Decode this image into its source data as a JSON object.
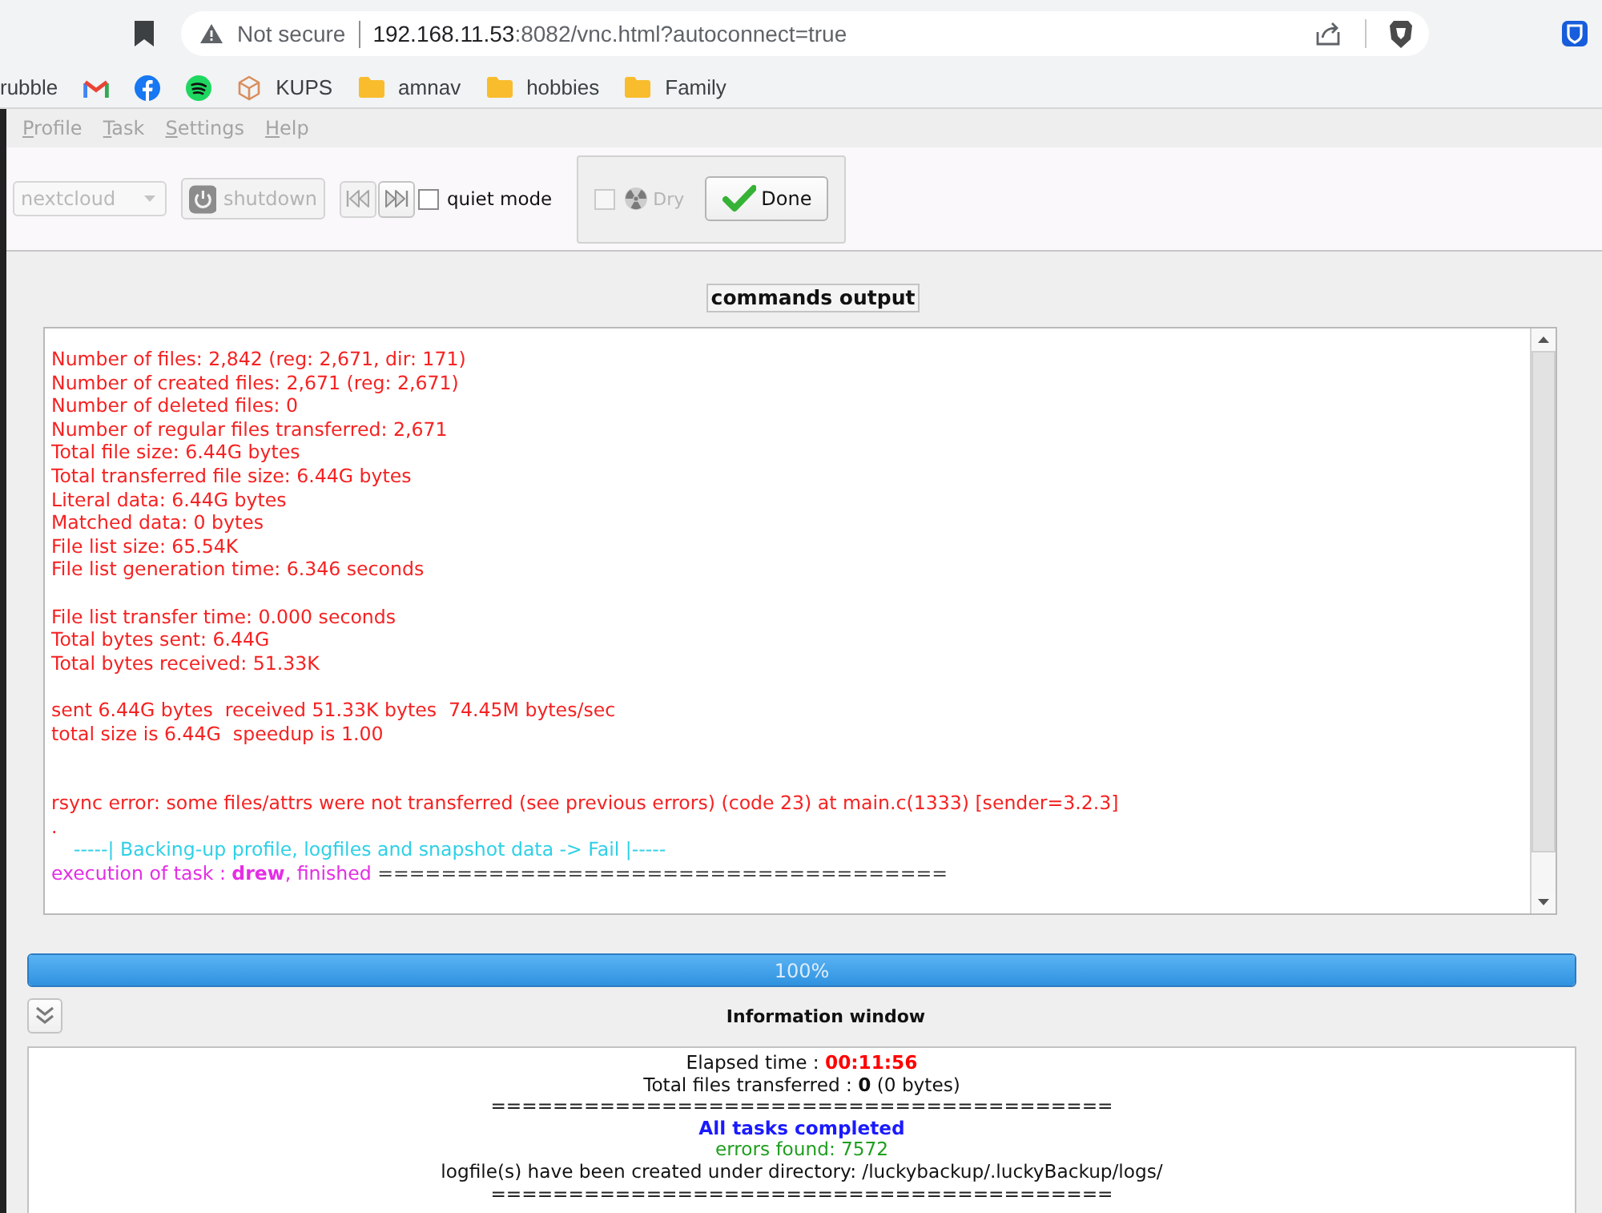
{
  "browser": {
    "address_bar": {
      "security_label": "Not secure",
      "host": "192.168.11.53",
      "path": ":8082/vnc.html?autoconnect=true"
    },
    "bookmarks": [
      {
        "kind": "text",
        "label": "rubble"
      },
      {
        "kind": "mail"
      },
      {
        "kind": "round-logo"
      },
      {
        "kind": "waves-logo"
      },
      {
        "kind": "cube",
        "label": "KUPS"
      },
      {
        "kind": "folder",
        "label": "amnav"
      },
      {
        "kind": "folder",
        "label": "hobbies"
      },
      {
        "kind": "folder",
        "label": "Family"
      }
    ]
  },
  "app": {
    "menu": [
      {
        "label": "Profile",
        "disabled": true
      },
      {
        "label": "Task",
        "disabled": true
      },
      {
        "label": "Settings",
        "disabled": true
      },
      {
        "label": "Help",
        "disabled": true
      }
    ],
    "toolbar": {
      "profile_combo": {
        "value": "nextcloud",
        "disabled": true
      },
      "shutdown_button": {
        "label": "shutdown",
        "disabled": true
      },
      "previous_button": {
        "disabled": true
      },
      "next_button": {
        "disabled": false
      },
      "quiet_mode": {
        "label": "quiet mode",
        "checked": false,
        "disabled": false
      },
      "dry_run": {
        "label": "Dry",
        "checked": false,
        "disabled": true
      },
      "done_button": {
        "label": "Done"
      }
    },
    "commands_output": {
      "title": "commands output",
      "lines": [
        {
          "kind": "rsync",
          "text": "Number of files: 2,842 (reg: 2,671, dir: 171)"
        },
        {
          "kind": "rsync",
          "text": "Number of created files: 2,671 (reg: 2,671)"
        },
        {
          "kind": "rsync",
          "text": "Number of deleted files: 0"
        },
        {
          "kind": "rsync",
          "text": "Number of regular files transferred: 2,671"
        },
        {
          "kind": "rsync",
          "text": "Total file size: 6.44G bytes"
        },
        {
          "kind": "rsync",
          "text": "Total transferred file size: 6.44G bytes"
        },
        {
          "kind": "rsync",
          "text": "Literal data: 6.44G bytes"
        },
        {
          "kind": "rsync",
          "text": "Matched data: 0 bytes"
        },
        {
          "kind": "rsync",
          "text": "File list size: 65.54K"
        },
        {
          "kind": "rsync",
          "text": "File list generation time: 6.346 seconds"
        },
        {
          "kind": "blank"
        },
        {
          "kind": "rsync",
          "text": "File list transfer time: 0.000 seconds"
        },
        {
          "kind": "rsync",
          "text": "Total bytes sent: 6.44G"
        },
        {
          "kind": "rsync",
          "text": "Total bytes received: 51.33K"
        },
        {
          "kind": "blank"
        },
        {
          "kind": "rsync",
          "text": "sent 6.44G bytes  received 51.33K bytes  74.45M bytes/sec"
        },
        {
          "kind": "rsync",
          "text": "total size is 6.44G  speedup is 1.00"
        },
        {
          "kind": "blank"
        },
        {
          "kind": "blank"
        },
        {
          "kind": "rsync",
          "text": "rsync error: some files/attrs were not transferred (see previous errors) (code 23) at main.c(1333) [sender=3.2.3]"
        },
        {
          "kind": "rsync",
          "text": "."
        },
        {
          "kind": "status",
          "text": "-----| Backing-up profile, logfiles and snapshot data -> Fail |-----"
        },
        {
          "kind": "task",
          "text": "execution of task : **drew**, finished",
          "rule": "===================================="
        }
      ]
    },
    "progress": {
      "level": 1,
      "reading": "100%"
    },
    "information_window": {
      "title": "Information window",
      "lines": [
        {
          "kind": "timer",
          "text": "Elapsed time : **00:11:56**"
        },
        {
          "kind": "plain",
          "text": "Total files transferred : **0** (0 bytes)"
        },
        {
          "kind": "rule",
          "text": "========================================"
        },
        {
          "kind": "success",
          "text": "All tasks completed"
        },
        {
          "kind": "errors",
          "text": "errors found: 7572"
        },
        {
          "kind": "plain",
          "text": "logfile(s) have been created under directory: /luckybackup/.luckyBackup/logs/"
        },
        {
          "kind": "rule",
          "text": "========================================"
        }
      ]
    }
  }
}
